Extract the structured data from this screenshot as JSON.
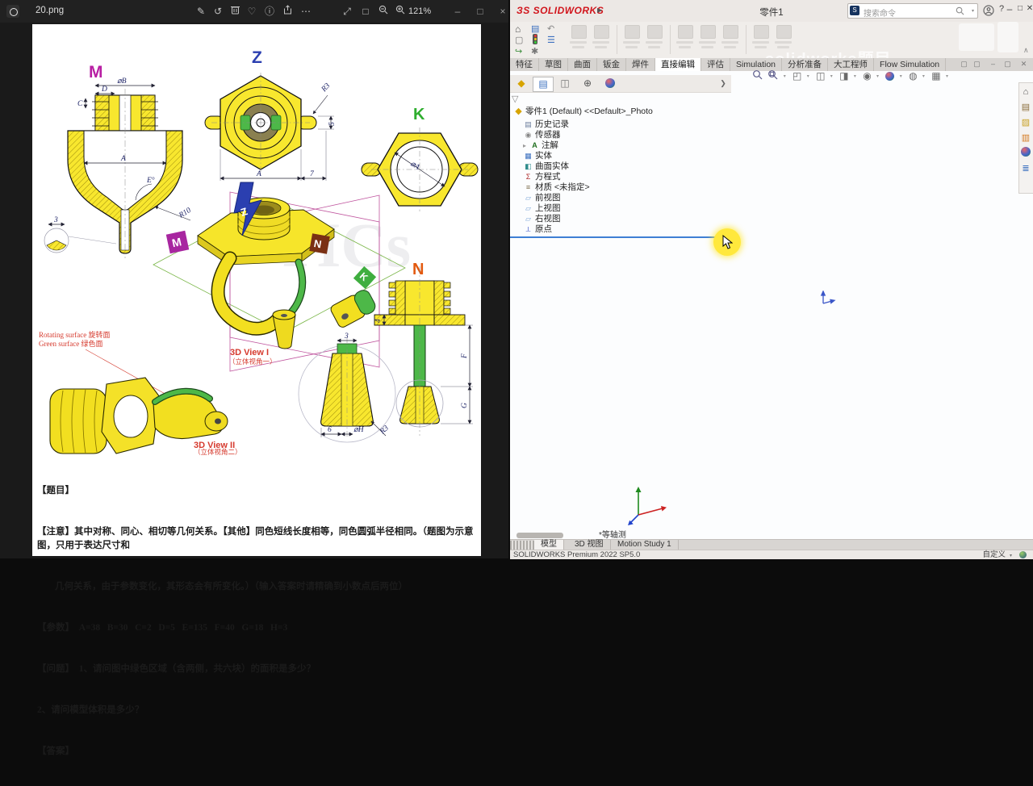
{
  "photos": {
    "titlebar": {
      "filename": "20.png",
      "zoom": "121%"
    },
    "icons": {
      "edit": "✎",
      "rotate": "↺",
      "favorite": "♡",
      "info": "ⓘ",
      "more": "⋯",
      "fullscreen": "⤢",
      "fit": "□",
      "min": "–",
      "max": "□",
      "close": "×"
    },
    "drawing": {
      "labels": {
        "m": "M",
        "z": "Z",
        "k": "K",
        "n": "N",
        "placard_m": "M",
        "placard_n": "N",
        "placard_k": "K",
        "arrow_z": "Z"
      },
      "dims": {
        "m_diaB": "⌀B",
        "m_D": "D",
        "m_C": "C",
        "m_A": "A",
        "m_E": "E°",
        "m_R10": "R10",
        "m_3": "3",
        "z_R3": "R3",
        "z_5": "5",
        "z_A": "A",
        "z_7": "7",
        "k_diaA": "⌀A",
        "n_4": "4",
        "n_F": "F",
        "n_G": "G",
        "d_3": "3",
        "d_6": "6",
        "d_diaH": "⌀H",
        "d_R3": "R3"
      },
      "view1_title": "3D View I",
      "view1_sub": "（立体视角一）",
      "view2_title": "3D View II",
      "view2_sub": "（立体视角二）",
      "note1": "Rotating surface 旋转面",
      "note2": "Green surface 绿色面",
      "watermark": "TICs"
    },
    "problem": {
      "lines": [
        "【题目】",
        "【注意】其中对称、同心、相切等几何关系。【其他】同色短线长度相等，同色圆弧半径相同。（题图为示意图，只用于表达尺寸和",
        "几何关系，由于参数变化，其形态会有所变化。）（输入答案时请精确到小数点后两位）",
        "【参数】  A=38   B=30   C=2   D=5   E=135   F=40   G=18   H=3",
        "【问题】  1、请问图中绿色区域（含两侧，共六块）的面积是多少？",
        "2、请问模型体积是多少？",
        "【答案】"
      ]
    }
  },
  "solidworks": {
    "titlebar": {
      "logo_mark": "ЗS",
      "logo_name": "SOLIDWORKS",
      "flyout": "▶",
      "title": "零件1",
      "search_placeholder": "搜索命令",
      "help": "?",
      "min": "–",
      "max": "□",
      "close": "✕"
    },
    "ribbon": {
      "collapse": "∧"
    },
    "tabs": [
      {
        "label": "特征"
      },
      {
        "label": "草图"
      },
      {
        "label": "曲面"
      },
      {
        "label": "钣金"
      },
      {
        "label": "焊件"
      },
      {
        "label": "直接编辑"
      },
      {
        "label": "评估"
      },
      {
        "label": "Simulation"
      },
      {
        "label": "分析准备"
      },
      {
        "label": "大工程师"
      },
      {
        "label": "Flow Simulation"
      }
    ],
    "tree": {
      "root": "零件1 (Default) <<Default>_Photo",
      "expand_glyph": "▸",
      "filter_glyph": "▽",
      "chevron": "❯",
      "items": [
        {
          "label": "历史记录"
        },
        {
          "label": "传感器"
        },
        {
          "label": "注解"
        },
        {
          "label": "实体"
        },
        {
          "label": "曲面实体"
        },
        {
          "label": "方程式"
        },
        {
          "label": "材质 <未指定>"
        },
        {
          "label": "前视图"
        },
        {
          "label": "上视图"
        },
        {
          "label": "右视图"
        },
        {
          "label": "原点"
        }
      ]
    },
    "icon_glyphs": {
      "history": "▤",
      "sensors": "◉",
      "annotations": "A",
      "solids": "▦",
      "surfaces": "◧",
      "equations": "Σ",
      "material": "≡",
      "plane": "▱",
      "origin": "⟂",
      "mgr_tree": "◆",
      "mgr_prop": "▤",
      "mgr_config": "◫",
      "mgr_target": "⊕",
      "hud_orient": "◰",
      "hud_section": "◫",
      "hud_display": "◨",
      "hud_eye": "◉",
      "hud_scene": "◍",
      "hud_monitor": "▦",
      "tp_home": "⌂",
      "tp_library": "▤",
      "tp_folder": "▨",
      "tp_toolbox": "▥",
      "tp_list": "≣",
      "qat_home": "⌂",
      "qat_save": "▤",
      "qat_new": "▢",
      "qat_list": "☰",
      "qat_open": "↪",
      "qat_undo": "↶",
      "qat_gear": "✱"
    },
    "viewport": {
      "orientation": "*等轴测"
    },
    "bottom_tabs": [
      {
        "label": "模型"
      },
      {
        "label": "3D 视图"
      },
      {
        "label": "Motion Study 1"
      }
    ],
    "statusbar": {
      "left": "SOLIDWORKS Premium 2022 SP5.0",
      "right": "自定义",
      "caret": "▾"
    },
    "watermark": "solidworks题目"
  }
}
